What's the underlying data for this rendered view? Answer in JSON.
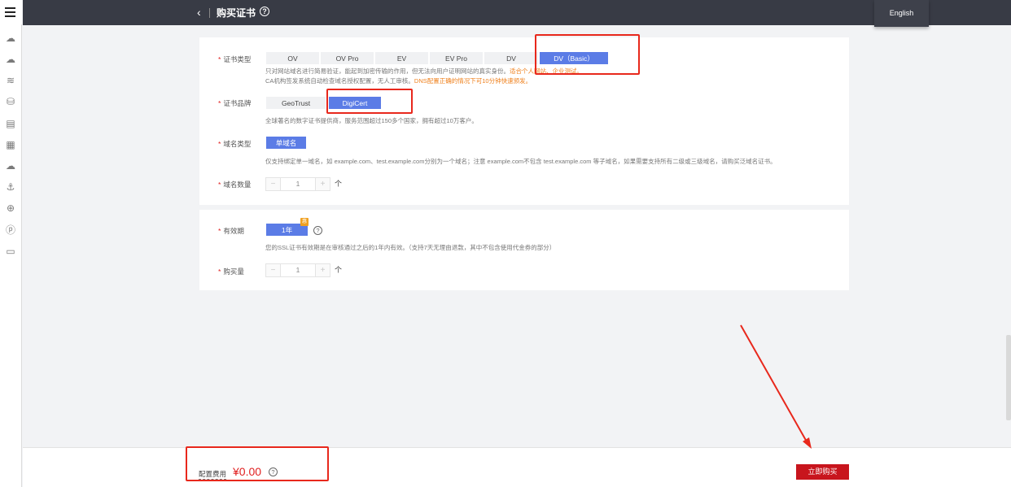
{
  "topbar": {
    "back_icon": "‹",
    "title": "购买证书",
    "help_icon": "?",
    "language": "English"
  },
  "rail": {
    "menu_icon": "hamburger-icon",
    "icons": [
      "cloud-icon",
      "cloud-outline-icon",
      "waves-icon",
      "cloud-drive-icon",
      "document-icon",
      "file-icon",
      "cloud-up-icon",
      "anchor-icon",
      "globe-icon",
      "p-circle-icon",
      "list-icon"
    ]
  },
  "form": {
    "cert_type": {
      "label": "证书类型",
      "options": [
        "OV",
        "OV Pro",
        "EV",
        "EV Pro",
        "DV",
        "DV（Basic）"
      ],
      "selected": "DV（Basic）",
      "desc_line1_prefix": "只对网站域名进行简易验证，能起到加密传输的作用，但无法向用户证明网站的真实身份。",
      "desc_line1_highlight": "适合个人网站、企业测试。",
      "desc_line2_prefix": "CA机构签发系统自动检查域名授权配置，无人工审核。",
      "desc_line2_highlight": "DNS配置正确的情况下可10分钟快速颁发。"
    },
    "cert_brand": {
      "label": "证书品牌",
      "options": [
        "GeoTrust",
        "DigiCert"
      ],
      "selected": "DigiCert",
      "desc": "全球著名的数字证书提供商，服务范围超过150多个国家，拥有超过10万客户。"
    },
    "domain_type": {
      "label": "域名类型",
      "options": [
        "单域名"
      ],
      "selected": "单域名",
      "desc": "仅支持绑定单一域名，如 example.com、test.example.com分别为一个域名；注意 example.com不包含 test.example.com 等子域名，如果需要支持所有二级或三级域名，请购买泛域名证书。"
    },
    "domain_count": {
      "label": "域名数量",
      "minus": "−",
      "value": "1",
      "plus": "+",
      "unit": "个"
    },
    "validity": {
      "label": "有效期",
      "option": "1年",
      "badge": "惠",
      "help_icon": "?",
      "desc": "您的SSL证书有效期是在审核通过之后的1年内有效。（支持7天无理由退款，其中不包含使用代金券的部分）"
    },
    "purchase_qty": {
      "label": "购买量",
      "minus": "−",
      "value": "1",
      "plus": "+",
      "unit": "个"
    }
  },
  "footer": {
    "cost_label": "配置费用",
    "cost_value": "¥0.00",
    "help_icon": "?",
    "buy_label": "立即购买"
  },
  "colors": {
    "accent": "#5b7ce6",
    "buy": "#c8151d",
    "annotation": "#e8281c",
    "topbar": "#383b45"
  }
}
